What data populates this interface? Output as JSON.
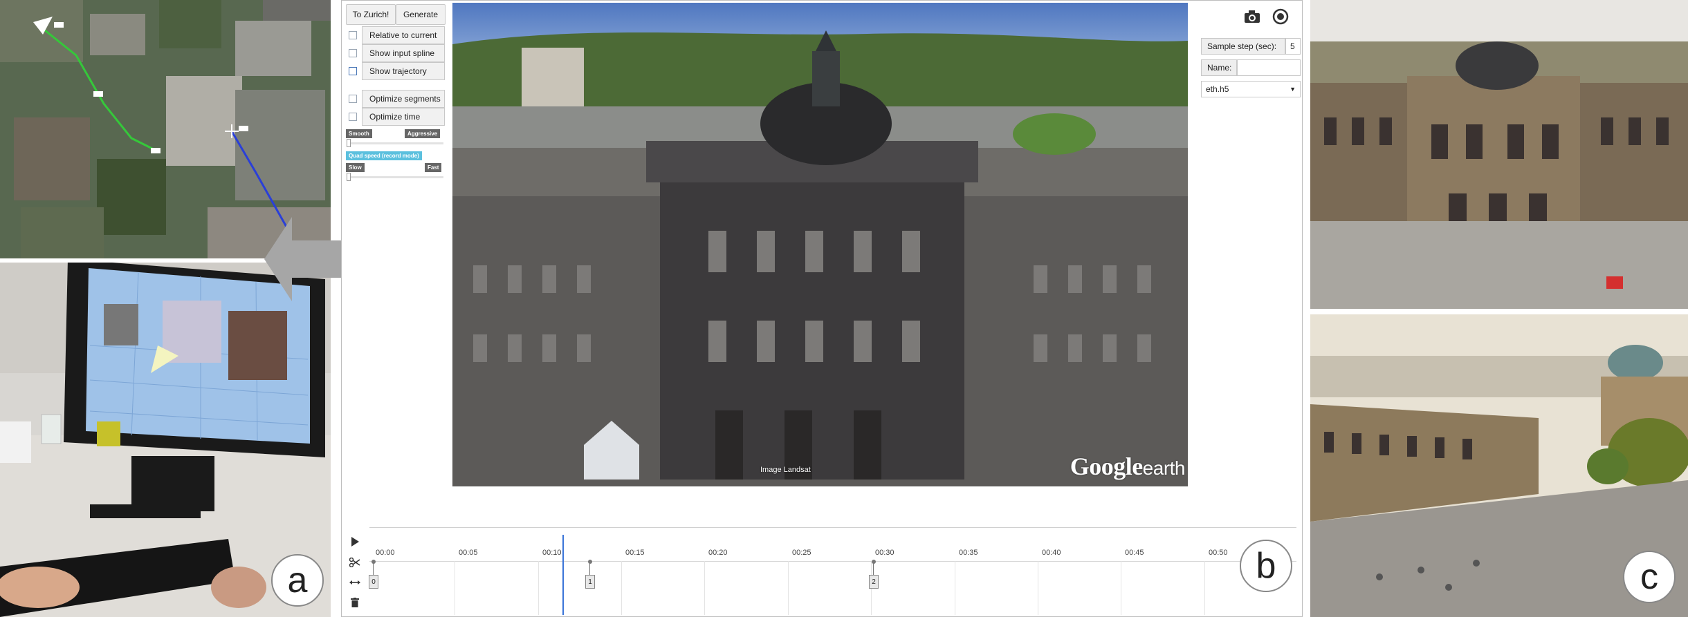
{
  "panels": {
    "a": "a",
    "b": "b",
    "c": "c"
  },
  "toolbar": {
    "to_zurich": "To Zurich!",
    "generate": "Generate"
  },
  "options": {
    "relative_to_current": "Relative to current",
    "show_input_spline": "Show input spline",
    "show_trajectory": "Show trajectory",
    "optimize_segments": "Optimize segments",
    "optimize_time": "Optimize time"
  },
  "sliders": {
    "mode_min": "Smooth",
    "mode_max": "Aggressive",
    "speed_title": "Quad speed (record mode)",
    "speed_min": "Slow",
    "speed_max": "Fast"
  },
  "properties": {
    "sample_step_label": "Sample step (sec):",
    "sample_step_value": "5",
    "name_label": "Name:",
    "name_value": "",
    "file_select": "eth.h5"
  },
  "viewport": {
    "brand_main": "Google",
    "brand_sub": "earth",
    "credit": "Image Landsat"
  },
  "timeline": {
    "ticks": [
      "00:00",
      "00:05",
      "00:10",
      "00:15",
      "00:20",
      "00:25",
      "00:30",
      "00:35",
      "00:40",
      "00:45",
      "00:50"
    ],
    "playhead": "00:10",
    "keyframes": [
      "0",
      "1",
      "2"
    ]
  },
  "map": {
    "waypoints": [
      "001",
      "002",
      "003",
      "004"
    ]
  },
  "icons": {
    "play": "play-icon",
    "cut": "scissors-icon",
    "stretch": "stretch-icon",
    "delete": "trash-icon",
    "camera": "camera-icon",
    "record": "record-icon"
  },
  "colors": {
    "accent": "#5bc0de",
    "path_green": "#35c83a",
    "path_blue": "#2a3fd8",
    "playhead": "#3a74d8",
    "tag_dark": "#666666"
  }
}
